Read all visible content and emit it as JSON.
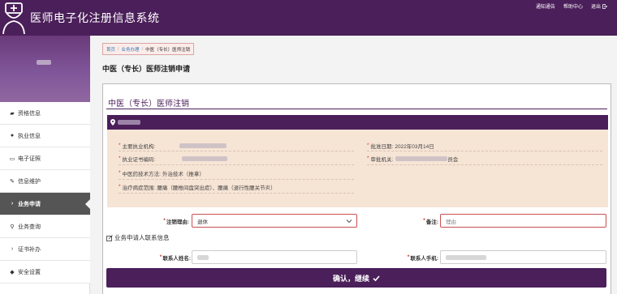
{
  "header": {
    "title": "医师电子化注册信息系统",
    "links": [
      "通知通告",
      "帮助中心",
      "退出"
    ]
  },
  "sidebar": {
    "items": [
      {
        "label": "资格信息",
        "icon": "book-icon"
      },
      {
        "label": "执业信息",
        "icon": "users-icon"
      },
      {
        "label": "电子证照",
        "icon": "card-icon"
      },
      {
        "label": "信息维护",
        "icon": "edit-icon"
      },
      {
        "label": "业务申请",
        "icon": "chevron-right-icon",
        "active": true
      },
      {
        "label": "业务查询",
        "icon": "search-icon"
      },
      {
        "label": "证书补办",
        "icon": "arrow-right-icon"
      },
      {
        "label": "安全设置",
        "icon": "shield-icon"
      }
    ]
  },
  "breadcrumb": [
    "首页",
    "业务办理",
    "中医（专长）医师注销"
  ],
  "page_title": "中医（专长）医师注销申请",
  "panel": {
    "title": "中医（专长）医师注销",
    "info": {
      "main_org_label": "主要执业机构:",
      "cert_no_label": "执业证书编码:",
      "method_label": "中医药技术方法:",
      "method_value": "外治技术（推拿）",
      "scope_label": "治疗病症范围:",
      "scope_value": "腰痛（腰椎间盘突出症）、腰痛（退行性腰关节炎）",
      "approve_date_label": "批准日期:",
      "approve_date_value": "2022年03月14日",
      "approve_org_label": "审批机关:",
      "approve_org_suffix": "员会"
    },
    "form": {
      "reason_label": "注销理由:",
      "reason_value": "退休",
      "remark_label": "备注:",
      "remark_placeholder": "理由",
      "contact_section": "业务申请人联系信息",
      "contact_name_label": "联系人姓名:",
      "contact_phone_label": "联系人手机:",
      "submit_label": "确认，继续"
    }
  },
  "colors": {
    "brand": "#4b1f5a",
    "info_bg": "#f6e4d5",
    "required": "#c0392b"
  }
}
